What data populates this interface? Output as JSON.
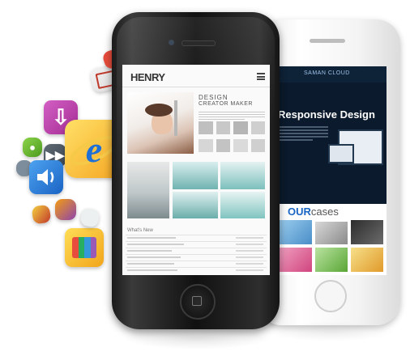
{
  "black_phone": {
    "logo": "HENRY",
    "heading_line1": "DESIGN",
    "heading_line2": "CREATOR MAKER",
    "list_title": "What's New"
  },
  "white_phone": {
    "brand": "SAMAN CLOUD",
    "banner_title": "Responsive Design",
    "cases_our": "OUR",
    "cases_word": "cases"
  },
  "icons": [
    "mail-icon",
    "download-icon",
    "chat-icon",
    "internet-explorer-icon",
    "speaker-icon",
    "tv-icon",
    "gallery-icon",
    "note-icon"
  ],
  "colors": {
    "ie_blue": "#1e6fd6",
    "ie_orange": "#f5a623",
    "dark_screen": "#0b1a2c"
  }
}
